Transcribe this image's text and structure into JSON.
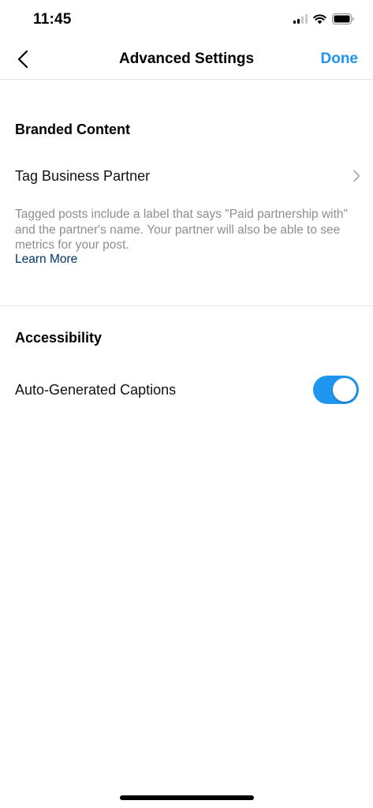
{
  "status_bar": {
    "time": "11:45"
  },
  "nav": {
    "title": "Advanced Settings",
    "done_label": "Done"
  },
  "branded_content": {
    "header": "Branded Content",
    "tag_partner_label": "Tag Business Partner",
    "helper_text": "Tagged posts include a label that says \"Paid partnership with\" and the partner's name. Your partner will also be able to see metrics for your post.",
    "learn_more_label": "Learn More"
  },
  "accessibility": {
    "header": "Accessibility",
    "captions_label": "Auto-Generated Captions",
    "captions_enabled": true
  },
  "colors": {
    "accent": "#1e96f0",
    "link": "#00376b",
    "muted_text": "#8e8e8e",
    "divider": "#e6e6e6"
  },
  "icons": {
    "back": "chevron-left-icon",
    "row_chevron": "chevron-right-icon",
    "signal": "cellular-signal-icon",
    "wifi": "wifi-icon",
    "battery": "battery-icon"
  }
}
